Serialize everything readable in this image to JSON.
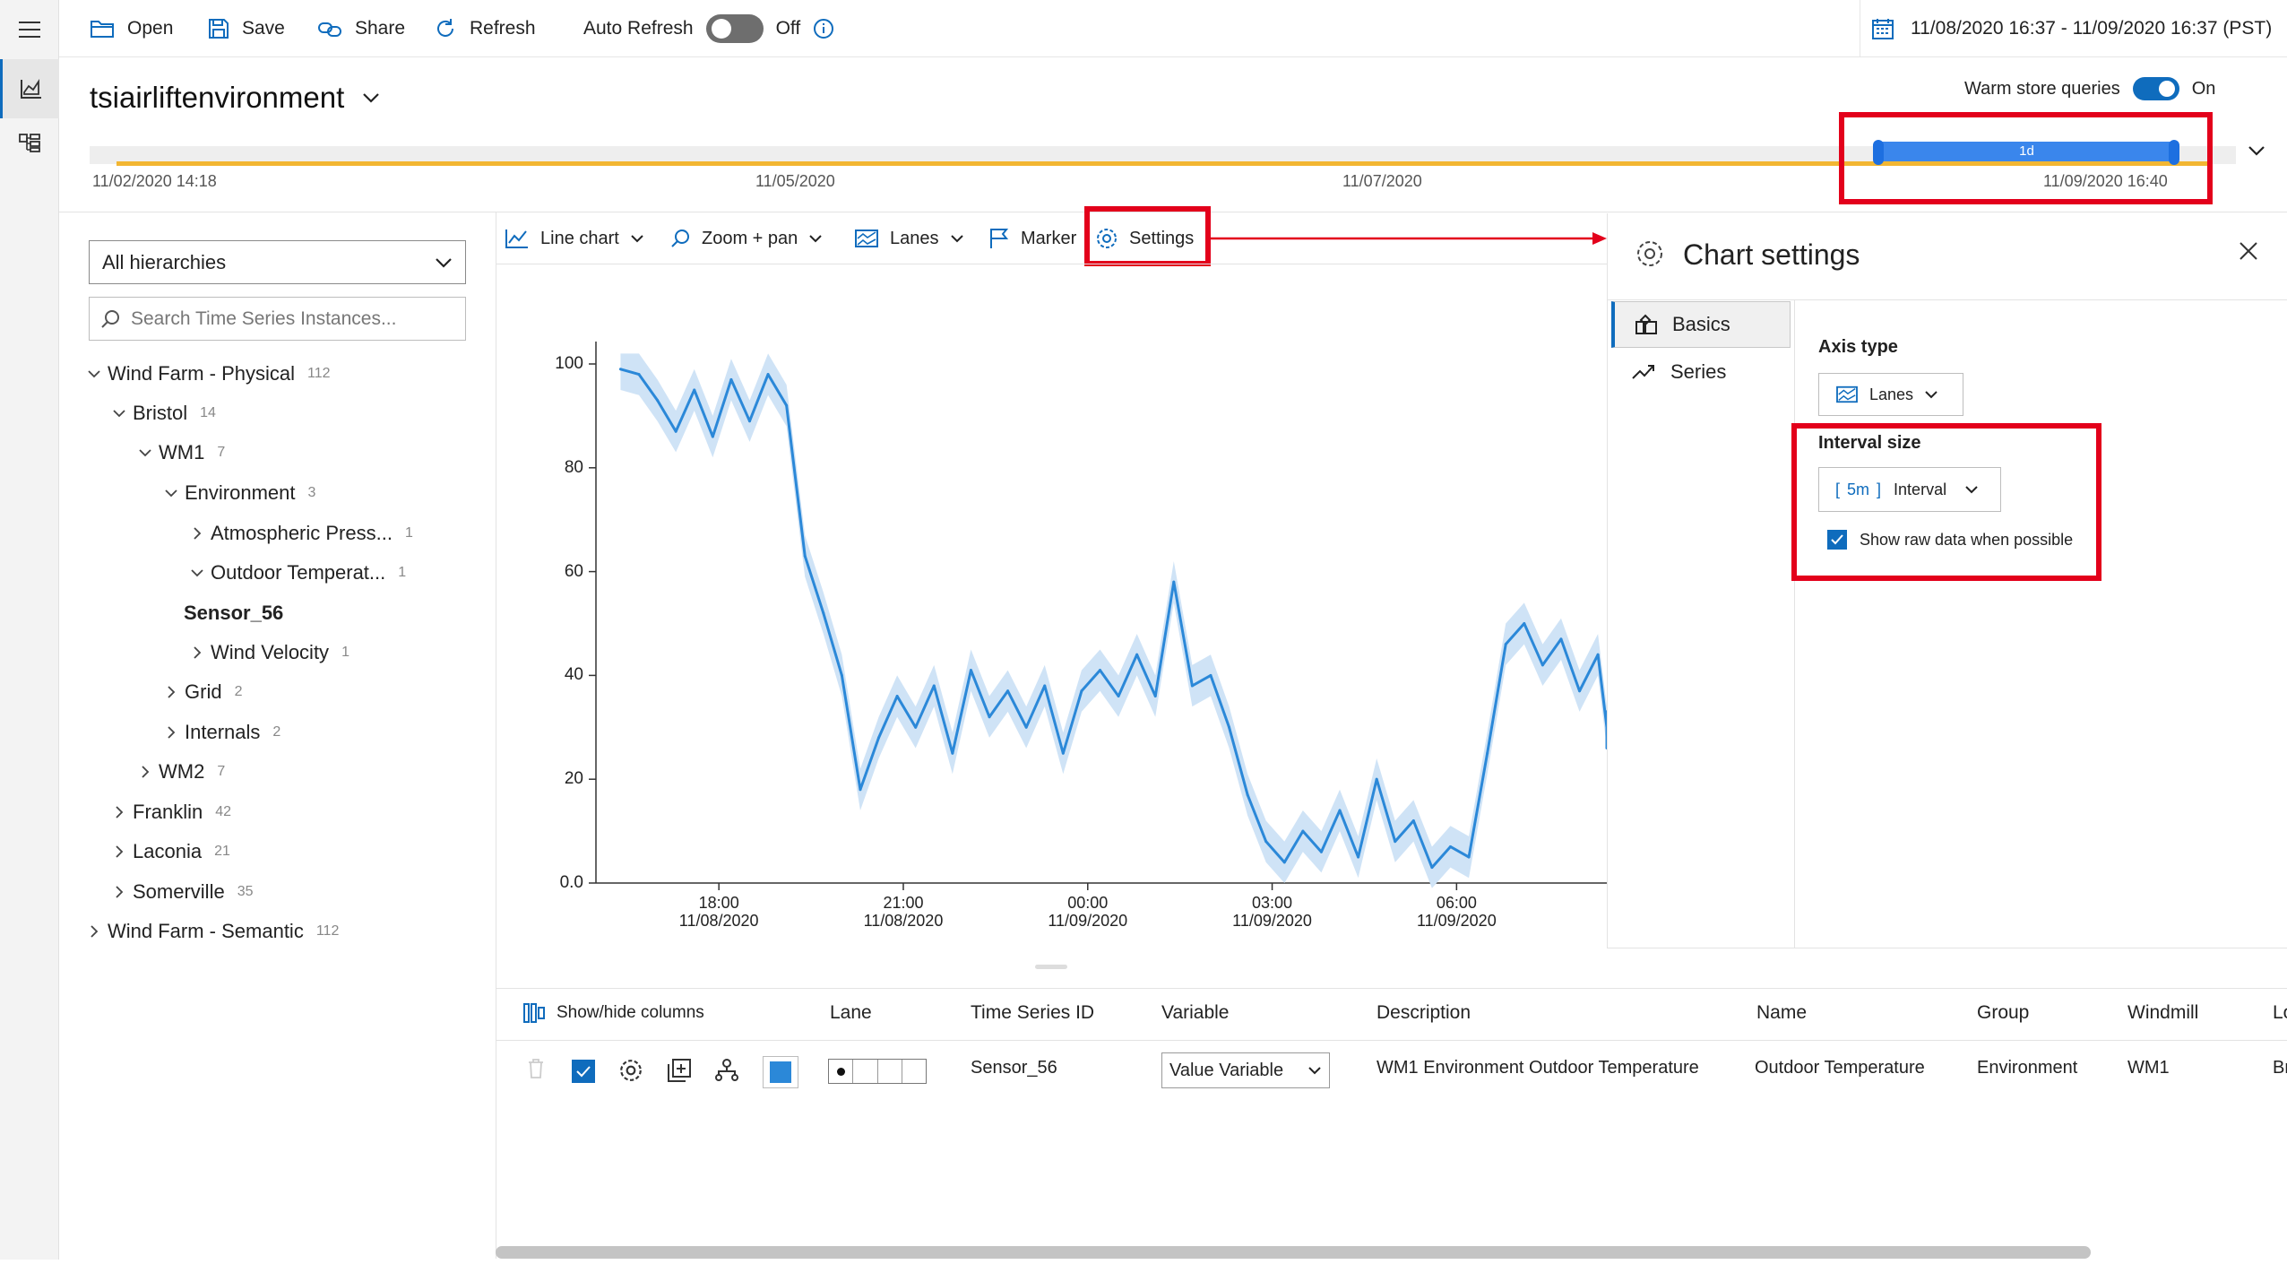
{
  "toolbar": {
    "open": "Open",
    "save": "Save",
    "share": "Share",
    "refresh": "Refresh",
    "auto_refresh": "Auto Refresh",
    "auto_refresh_state": "Off"
  },
  "date_range": "11/08/2020 16:37 - 11/09/2020 16:37 (PST)",
  "environment": "tsiairliftenvironment",
  "warm_store": {
    "label": "Warm store queries",
    "state": "On"
  },
  "availability": {
    "ticks": [
      "11/02/2020 14:18",
      "11/05/2020",
      "11/07/2020"
    ],
    "brush_label": "1d",
    "brush_end": "11/09/2020 16:40"
  },
  "hierarchy": {
    "select": "All hierarchies",
    "search_placeholder": "Search Time Series Instances...",
    "tree": [
      {
        "label": "Wind Farm - Physical",
        "count": "112"
      },
      {
        "label": "Bristol",
        "count": "14"
      },
      {
        "label": "WM1",
        "count": "7"
      },
      {
        "label": "Environment",
        "count": "3"
      },
      {
        "label": "Atmospheric Press...",
        "count": "1"
      },
      {
        "label": "Outdoor Temperat...",
        "count": "1"
      },
      {
        "label": "Sensor_56",
        "count": ""
      },
      {
        "label": "Wind Velocity",
        "count": "1"
      },
      {
        "label": "Grid",
        "count": "2"
      },
      {
        "label": "Internals",
        "count": "2"
      },
      {
        "label": "WM2",
        "count": "7"
      },
      {
        "label": "Franklin",
        "count": "42"
      },
      {
        "label": "Laconia",
        "count": "21"
      },
      {
        "label": "Somerville",
        "count": "35"
      },
      {
        "label": "Wind Farm - Semantic",
        "count": "112"
      }
    ]
  },
  "chart_toolbar": {
    "line_chart": "Line chart",
    "zoom_pan": "Zoom + pan",
    "lanes": "Lanes",
    "marker": "Marker",
    "settings": "Settings"
  },
  "chart_data": {
    "type": "line",
    "title": "",
    "xlabel": "",
    "ylabel": "",
    "ylim": [
      0,
      100
    ],
    "y_ticks": [
      "0.0",
      "20",
      "40",
      "60",
      "80",
      "100"
    ],
    "x_ticks": [
      {
        "time": "18:00",
        "date": "11/08/2020"
      },
      {
        "time": "21:00",
        "date": "11/08/2020"
      },
      {
        "time": "00:00",
        "date": "11/09/2020"
      },
      {
        "time": "03:00",
        "date": "11/09/2020"
      },
      {
        "time": "06:00",
        "date": "11/09/2020"
      }
    ],
    "x_hours": [
      16.4,
      16.7,
      17.0,
      17.3,
      17.6,
      17.9,
      18.2,
      18.5,
      18.8,
      19.1,
      19.4,
      19.7,
      20.0,
      20.3,
      20.6,
      20.9,
      21.2,
      21.5,
      21.8,
      22.1,
      22.4,
      22.7,
      23.0,
      23.3,
      23.6,
      23.9,
      24.2,
      24.5,
      24.8,
      25.1,
      25.4,
      25.7,
      26.0,
      26.3,
      26.6,
      26.9,
      27.2,
      27.5,
      27.8,
      28.1,
      28.4,
      28.7,
      29.0,
      29.3,
      29.6,
      29.9,
      30.2,
      30.5,
      30.8,
      31.1,
      31.4,
      31.7,
      32.0,
      32.3,
      32.6,
      32.9,
      33.1
    ],
    "series": [
      {
        "color": "#2b88d8",
        "values": [
          99,
          98,
          93,
          87,
          95,
          86,
          97,
          89,
          98,
          92,
          63,
          52,
          40,
          18,
          28,
          36,
          30,
          38,
          25,
          41,
          32,
          37,
          30,
          38,
          25,
          37,
          41,
          36,
          44,
          36,
          58,
          38,
          40,
          30,
          17,
          8,
          4,
          10,
          6,
          14,
          5,
          20,
          8,
          12,
          3,
          7,
          5,
          25,
          46,
          50,
          42,
          47,
          37,
          44,
          30,
          33,
          26
        ],
        "band": 4
      }
    ]
  },
  "settings": {
    "title": "Chart settings",
    "nav": [
      "Basics",
      "Series"
    ],
    "axis_type_label": "Axis type",
    "axis_type_value": "Lanes",
    "interval_label": "Interval size",
    "interval_value": "5m",
    "interval_text": "Interval",
    "raw_data_label": "Show raw data when possible"
  },
  "table": {
    "show_hide": "Show/hide columns",
    "headers": [
      "Lane",
      "Time Series ID",
      "Variable",
      "Description",
      "Name",
      "Group",
      "Windmill",
      "Lo"
    ],
    "row": {
      "id": "Sensor_56",
      "variable": "Value Variable",
      "description": "WM1 Environment Outdoor Temperature",
      "name": "Outdoor Temperature",
      "group": "Environment",
      "windmill": "WM1",
      "cut": "Br"
    }
  },
  "colors": {
    "accent": "#0f6cbd",
    "highlight": "#e3001b",
    "availability": "#f2b632",
    "series": "#2b88d8"
  }
}
